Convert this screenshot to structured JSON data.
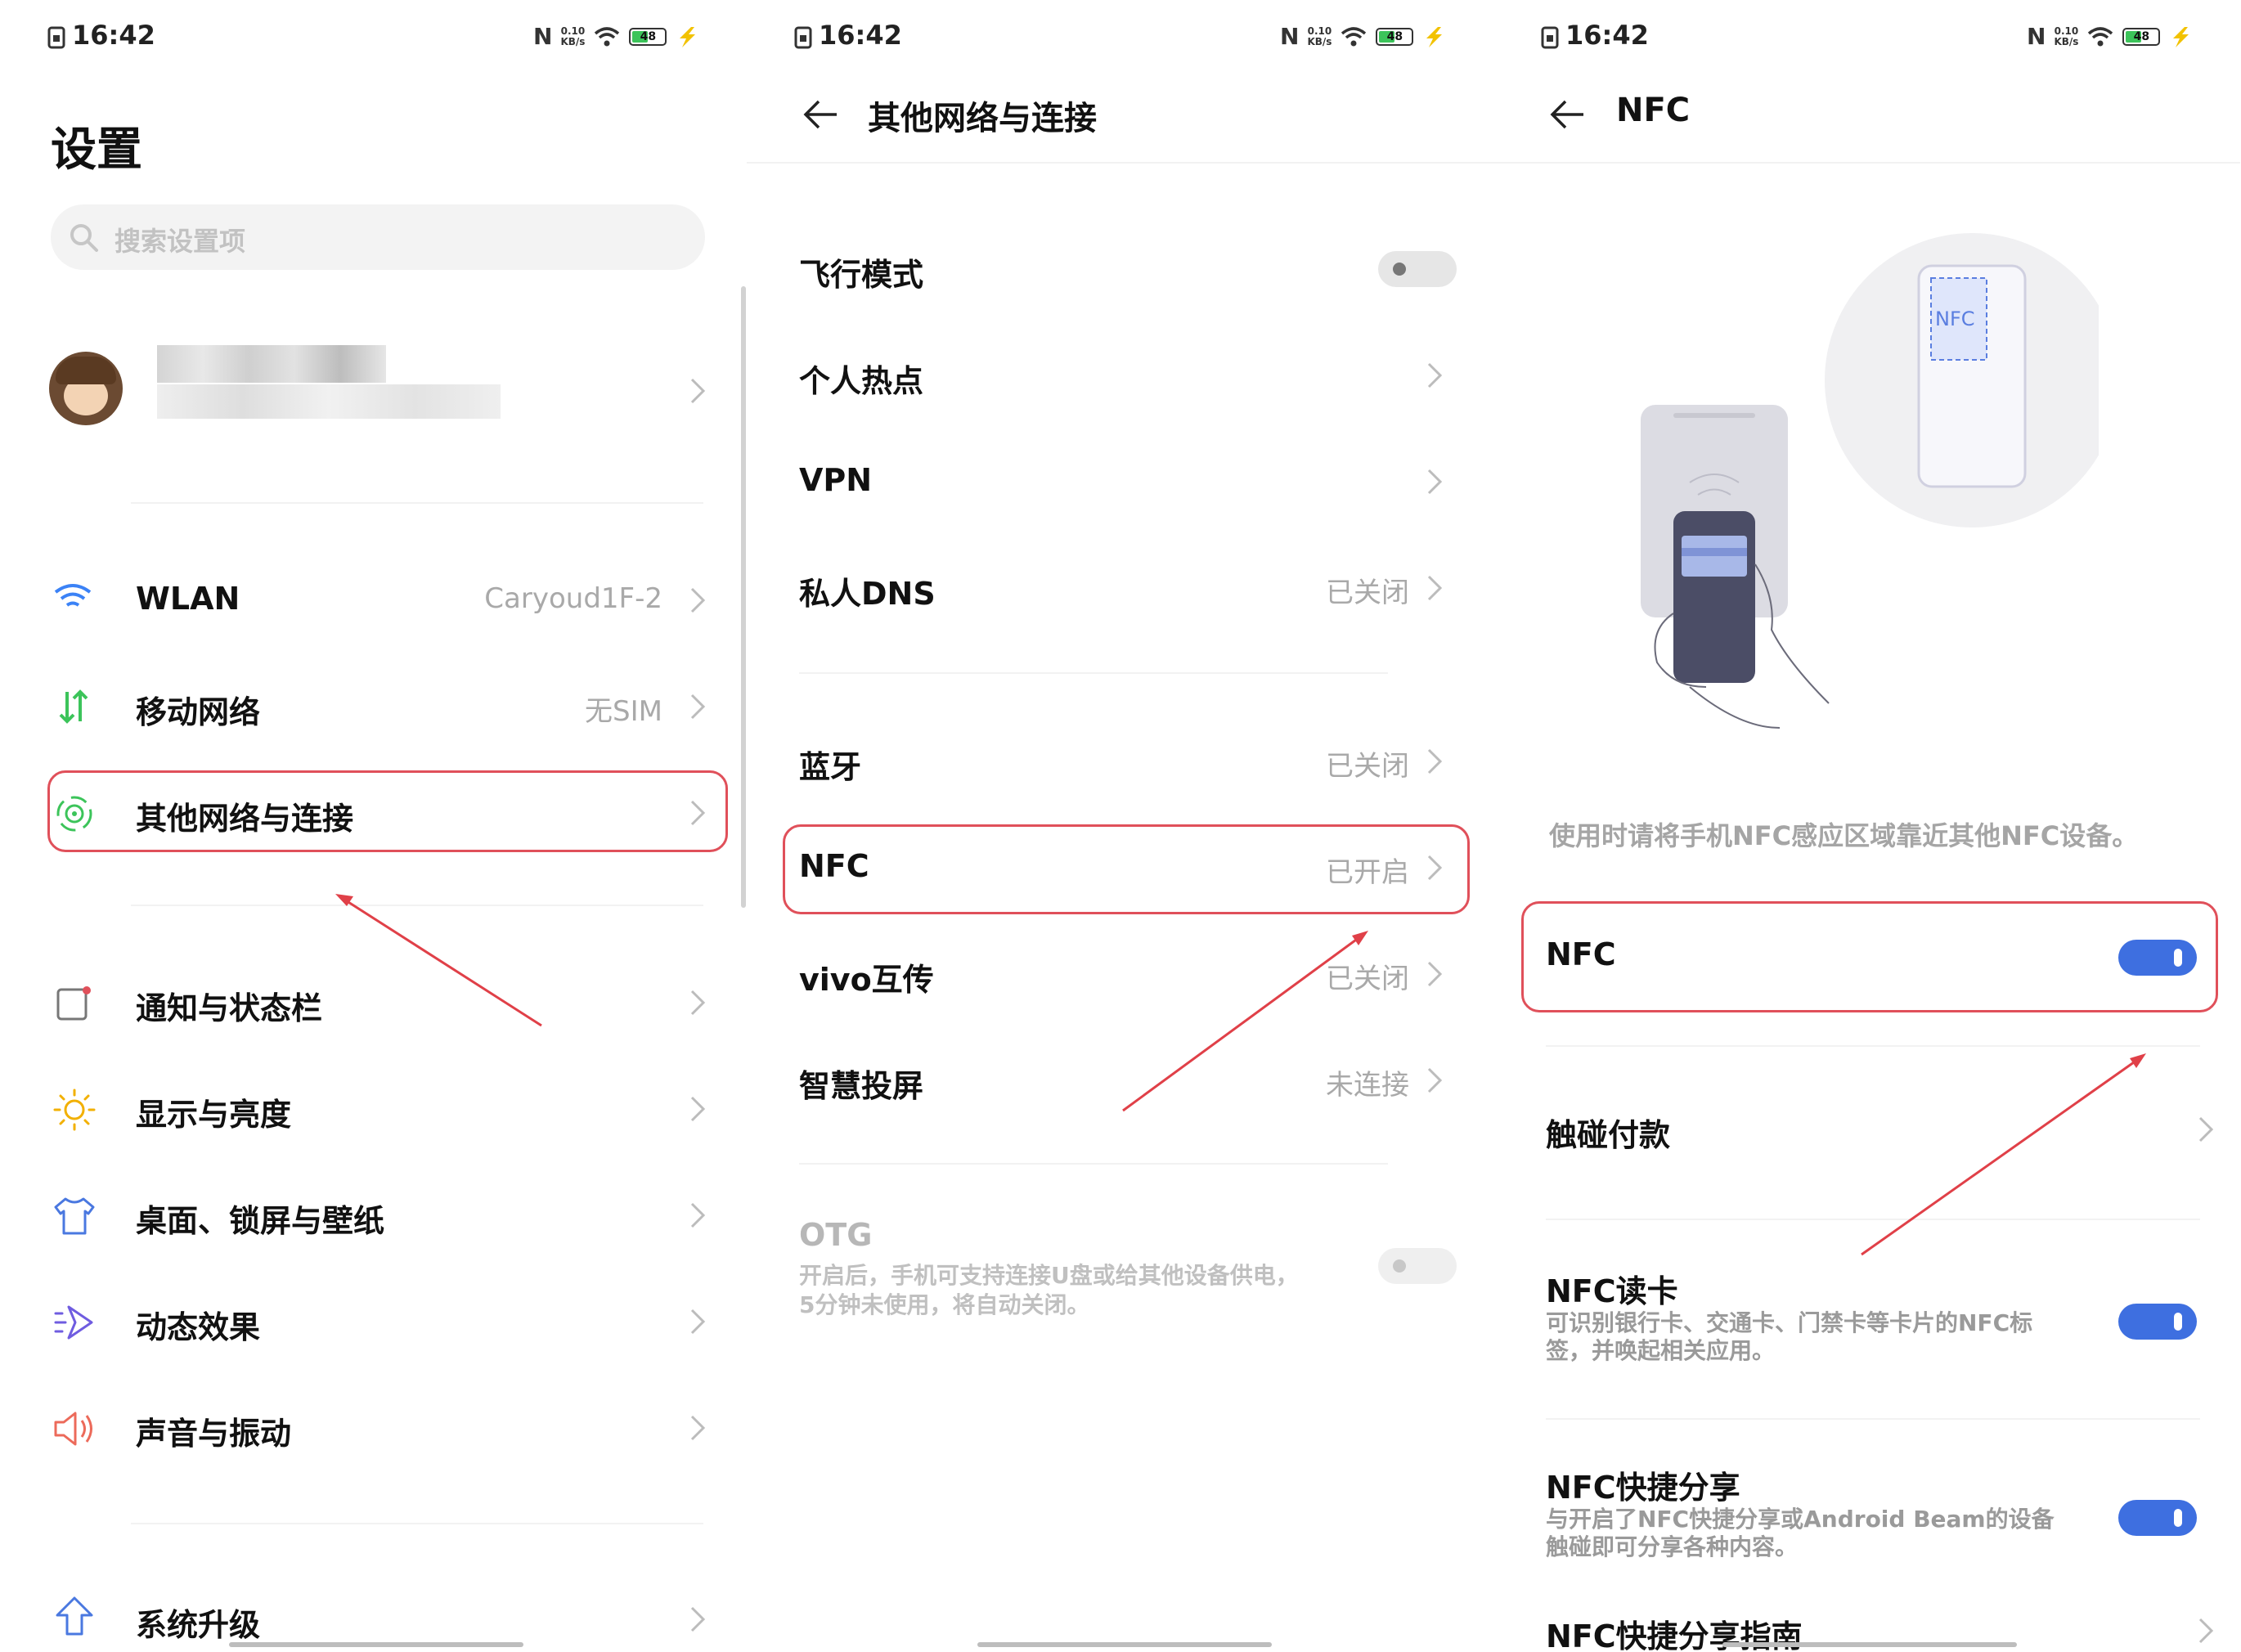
{
  "status_bar": {
    "time": "16:42",
    "speed_top": "0.10",
    "speed_bottom": "KB/s",
    "battery": "48",
    "nfc_mark": "N"
  },
  "screen1": {
    "title": "设置",
    "search_placeholder": "搜索设置项",
    "items": [
      {
        "label": "WLAN",
        "value": "Caryoud1F-2"
      },
      {
        "label": "移动网络",
        "value": "无SIM"
      },
      {
        "label": "其他网络与连接",
        "value": ""
      },
      {
        "label": "通知与状态栏",
        "value": ""
      },
      {
        "label": "显示与亮度",
        "value": ""
      },
      {
        "label": "桌面、锁屏与壁纸",
        "value": ""
      },
      {
        "label": "动态效果",
        "value": ""
      },
      {
        "label": "声音与振动",
        "value": ""
      },
      {
        "label": "系统升级",
        "value": ""
      }
    ]
  },
  "screen2": {
    "title": "其他网络与连接",
    "items": [
      {
        "label": "飞行模式",
        "value": ""
      },
      {
        "label": "个人热点",
        "value": ""
      },
      {
        "label": "VPN",
        "value": ""
      },
      {
        "label": "私人DNS",
        "value": "已关闭"
      },
      {
        "label": "蓝牙",
        "value": "已关闭"
      },
      {
        "label": "NFC",
        "value": "已开启"
      },
      {
        "label": "vivo互传",
        "value": "已关闭"
      },
      {
        "label": "智慧投屏",
        "value": "未连接"
      }
    ],
    "otg": {
      "label": "OTG",
      "desc_line1": "开启后，手机可支持连接U盘或给其他设备供电，",
      "desc_line2": "5分钟未使用，将自动关闭。"
    }
  },
  "screen3": {
    "title": "NFC",
    "illustration_tag": "NFC",
    "hint": "使用时请将手机NFC感应区域靠近其他NFC设备。",
    "nfc_toggle_label": "NFC",
    "pay_label": "触碰付款",
    "reader": {
      "label": "NFC读卡",
      "line1": "可识别银行卡、交通卡、门禁卡等卡片的NFC标",
      "line2": "签，并唤起相关应用。"
    },
    "share": {
      "label": "NFC快捷分享",
      "line1": "与开启了NFC快捷分享或Android Beam的设备",
      "line2": "触碰即可分享各种内容。"
    },
    "guide_label": "NFC快捷分享指南"
  },
  "colors": {
    "accent": "#3e6fe0",
    "highlight": "#e0505a",
    "arrow": "#e04048",
    "wifi": "#3b82f6",
    "green": "#3cc45a"
  }
}
